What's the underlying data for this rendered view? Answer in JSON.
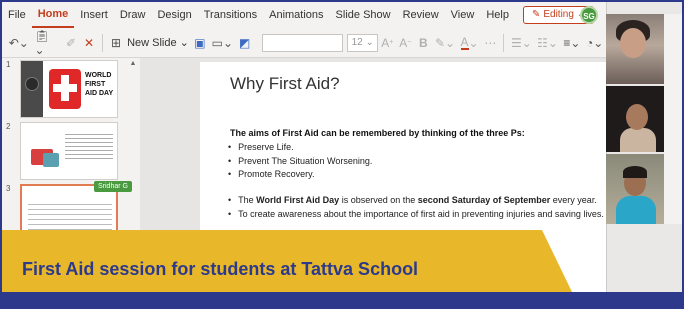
{
  "menu": {
    "items": [
      "File",
      "Home",
      "Insert",
      "Draw",
      "Design",
      "Transitions",
      "Animations",
      "Slide Show",
      "Review",
      "View",
      "Help"
    ],
    "active": "Home",
    "editing_label": "Editing",
    "avatar_initials": "SG"
  },
  "toolbar": {
    "new_slide_label": "New Slide",
    "font_size": "12",
    "icons": [
      "undo-icon",
      "clipboard-icon",
      "format-painter-icon",
      "delete-icon",
      "new-slide-icon",
      "layout-icon",
      "picture-icon",
      "grow-font-icon",
      "shrink-font-icon",
      "bold-icon",
      "highlight-icon",
      "font-color-icon",
      "more-icon",
      "bullets-icon",
      "numbering-icon",
      "align-icon",
      "shapes-icon"
    ]
  },
  "thumbnails": [
    {
      "number": "1",
      "text": "WORLD FIRST AID DAY"
    },
    {
      "number": "2"
    },
    {
      "number": "3",
      "collaborator": "Sridhar G"
    }
  ],
  "slide": {
    "title": "Why First Aid?",
    "aims_heading": "The aims of First Aid can be remembered by thinking of the three Ps:",
    "ps_bullets": [
      "Preserve Life.",
      "Prevent The Situation Worsening.",
      "Promote Recovery."
    ],
    "wfad_bullet": {
      "part1": "The ",
      "bold1": "World First Aid Day",
      "part2": " is observed on the ",
      "bold2": "second Saturday of September",
      "part3": " every year."
    },
    "awareness_bullet": "To create awareness about the importance of first aid in preventing injuries and saving lives."
  },
  "caption": {
    "text": "First Aid session for students at Tattva School"
  },
  "colors": {
    "accent": "#c43e1c",
    "banner_yellow": "#e8b82a",
    "banner_navy": "#2d3a8c"
  }
}
